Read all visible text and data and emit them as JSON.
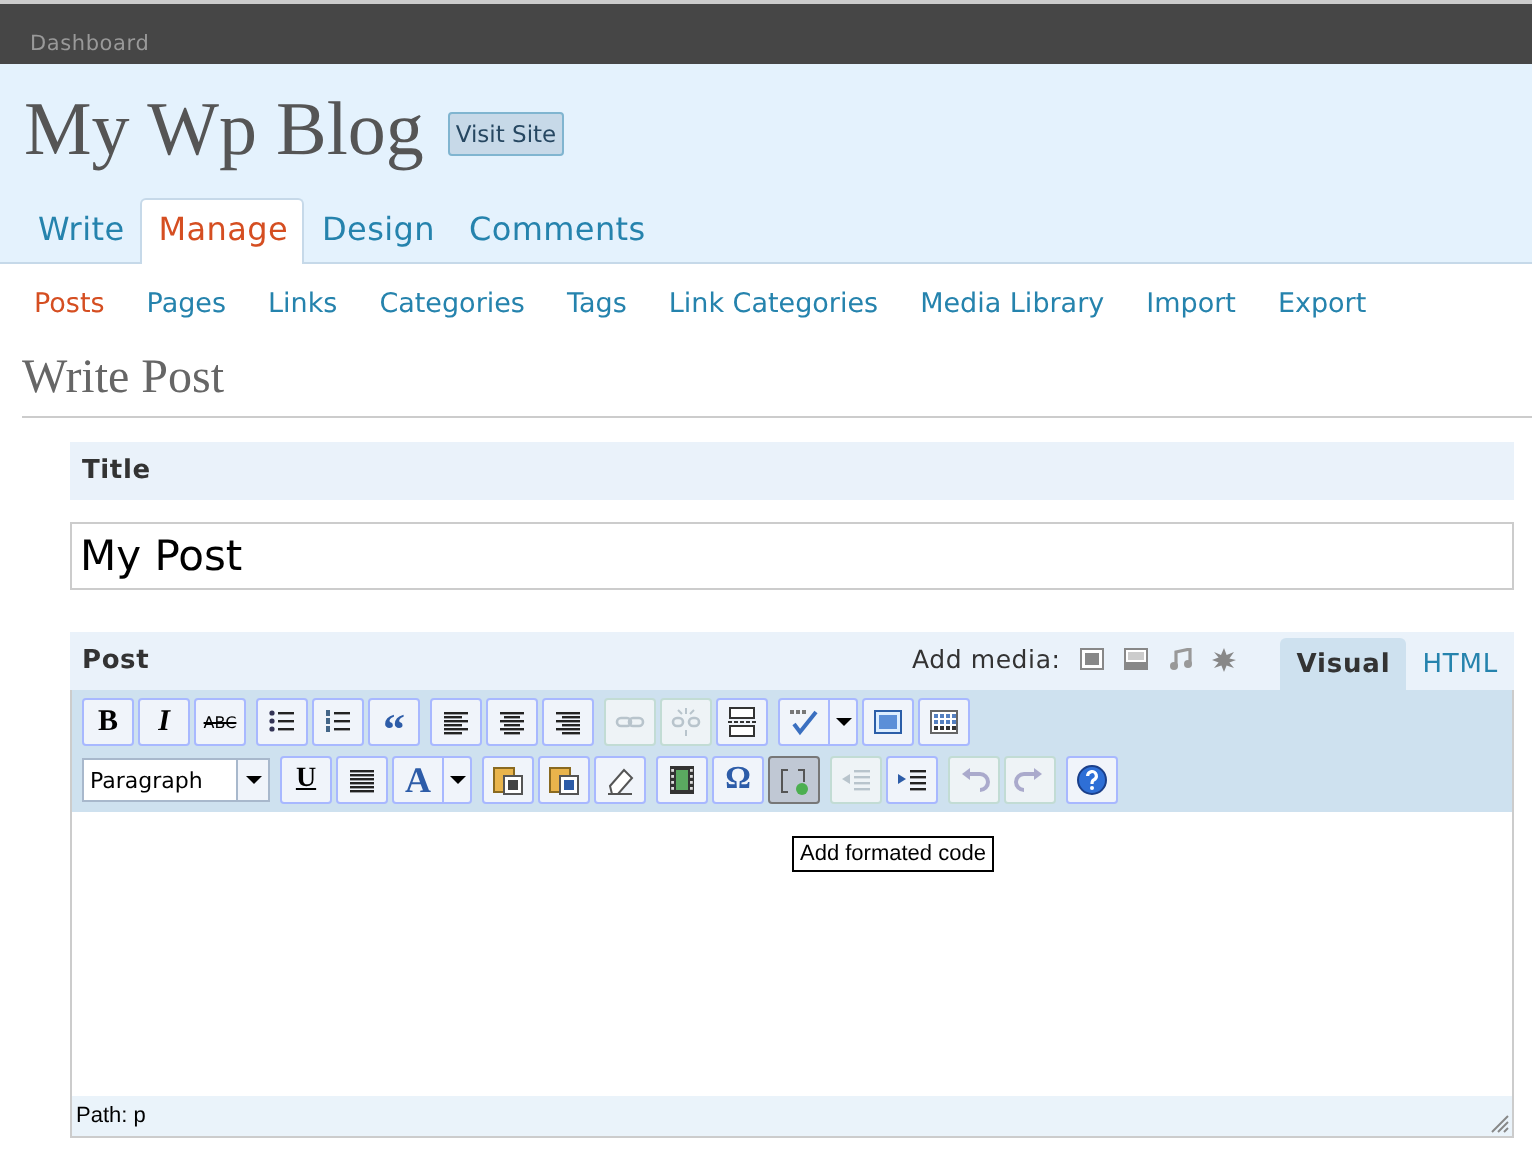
{
  "top_bar": {
    "link": "Dashboard"
  },
  "header": {
    "blog_title": "My Wp Blog",
    "visit_button": "Visit Site"
  },
  "tabs": [
    {
      "label": "Write",
      "selected": false
    },
    {
      "label": "Manage",
      "selected": true
    },
    {
      "label": "Design",
      "selected": false
    },
    {
      "label": "Comments",
      "selected": false
    }
  ],
  "submenu": [
    {
      "label": "Posts",
      "selected": true
    },
    {
      "label": "Pages",
      "selected": false
    },
    {
      "label": "Links",
      "selected": false
    },
    {
      "label": "Categories",
      "selected": false
    },
    {
      "label": "Tags",
      "selected": false
    },
    {
      "label": "Link Categories",
      "selected": false
    },
    {
      "label": "Media Library",
      "selected": false
    },
    {
      "label": "Import",
      "selected": false
    },
    {
      "label": "Export",
      "selected": false
    }
  ],
  "page_title": "Write Post",
  "title_box": {
    "heading": "Title",
    "value": "My Post"
  },
  "post_box": {
    "heading": "Post",
    "add_media_label": "Add media:",
    "media_buttons": [
      {
        "kind": "image"
      },
      {
        "kind": "video"
      },
      {
        "kind": "audio"
      },
      {
        "kind": "other"
      }
    ],
    "editor_tabs": [
      {
        "label": "Visual",
        "selected": true
      },
      {
        "label": "HTML",
        "selected": false
      }
    ],
    "toolbar_rows": [
      {
        "groups": [
          {
            "tools": [
              {
                "kind": "bold",
                "label": "B",
                "disabled": false,
                "active": false
              },
              {
                "kind": "italic",
                "label": "I",
                "disabled": false,
                "active": false
              },
              {
                "kind": "strikethrough",
                "label": "ABC",
                "disabled": false,
                "active": false
              }
            ]
          },
          {
            "tools": [
              {
                "kind": "bullets",
                "disabled": false,
                "active": false
              },
              {
                "kind": "numbers",
                "disabled": false,
                "active": false
              },
              {
                "kind": "quote",
                "label": "“",
                "disabled": false,
                "active": false
              }
            ]
          },
          {
            "tools": [
              {
                "kind": "align-left",
                "disabled": false,
                "active": false
              },
              {
                "kind": "align-center",
                "disabled": false,
                "active": false
              },
              {
                "kind": "align-right",
                "disabled": false,
                "active": false
              }
            ]
          },
          {
            "tools": [
              {
                "kind": "link",
                "disabled": true,
                "active": false
              },
              {
                "kind": "unlink",
                "disabled": true,
                "active": false
              },
              {
                "kind": "more",
                "disabled": false,
                "active": false
              }
            ]
          },
          {
            "tools": [
              {
                "kind": "spellcheck",
                "disabled": false,
                "active": false
              },
              {
                "kind": "fullscreen",
                "disabled": false,
                "active": false
              },
              {
                "kind": "kitchen-sink",
                "disabled": false,
                "active": false
              }
            ]
          }
        ]
      },
      {
        "groups": [
          {
            "tools": [
              {
                "kind": "select",
                "value": "Paragraph"
              }
            ]
          },
          {
            "tools": [
              {
                "kind": "underline",
                "label": "U",
                "disabled": false,
                "active": false
              },
              {
                "kind": "justify",
                "disabled": false,
                "active": false
              },
              {
                "kind": "text-color",
                "label": "A",
                "disabled": false,
                "active": false
              }
            ]
          },
          {
            "tools": [
              {
                "kind": "paste-text",
                "disabled": false,
                "active": false
              },
              {
                "kind": "paste-word",
                "disabled": false,
                "active": false
              },
              {
                "kind": "eraser",
                "disabled": false,
                "active": false
              }
            ]
          },
          {
            "tools": [
              {
                "kind": "media",
                "disabled": false,
                "active": false
              },
              {
                "kind": "charmap",
                "label": "Ω",
                "disabled": false,
                "active": false
              },
              {
                "kind": "code",
                "disabled": false,
                "active": true
              }
            ]
          },
          {
            "tools": [
              {
                "kind": "outdent",
                "disabled": true,
                "active": false
              },
              {
                "kind": "indent",
                "disabled": false,
                "active": false
              }
            ]
          },
          {
            "tools": [
              {
                "kind": "undo",
                "disabled": true,
                "active": false
              },
              {
                "kind": "redo",
                "disabled": true,
                "active": false
              }
            ]
          },
          {
            "tools": [
              {
                "kind": "help",
                "disabled": false,
                "active": false
              }
            ]
          }
        ]
      }
    ],
    "path": "Path: p",
    "tooltip": "Add formated code"
  }
}
